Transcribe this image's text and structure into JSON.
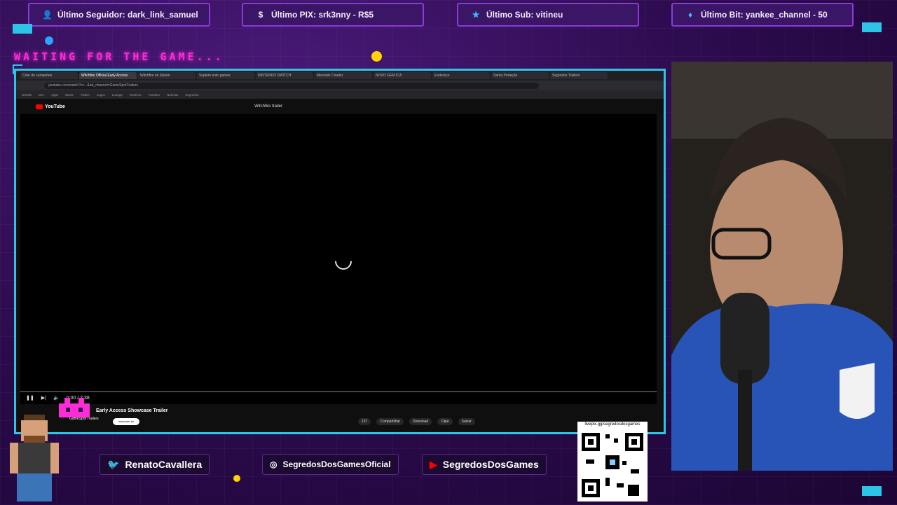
{
  "alerts": {
    "follower": "Último Seguidor: dark_link_samuel",
    "pix": "Último PIX: srk3nny - R$5",
    "sub": "Último Sub: vitineu",
    "bit": "Último Bit: yankee_channel - 50"
  },
  "overlay": {
    "waiting": "WAITING FOR THE GAME..."
  },
  "browser": {
    "tabs": [
      "Criar de campeões",
      "Witchfire Official Early Access",
      "Witchfire no Steam",
      "Suplem ento games",
      "NINTENDO SWITCH",
      "Mercado Criador",
      "NOVO GEM ICA",
      "Endereço",
      "Santa Proteção",
      "Segredos Trailers"
    ],
    "url": "youtube.com/watch?v=...&ab_channel=GameSpotTrailers",
    "bookmarks": [
      "GitHub",
      "Dev",
      "Apps",
      "Music",
      "Twitch",
      "Jogos",
      "Lounge",
      "Roteiros",
      "Fandom",
      "Notícias",
      "Segredos"
    ],
    "youtube_logo": "YouTube",
    "search_value": "Witchfire trailer"
  },
  "video": {
    "time": "0:00 / 2:38",
    "title": "Early Access Showcase Trailer",
    "channel": "GameSpot Trailers",
    "subscribe": "Inscrever-se",
    "actions": [
      "137",
      "Compartilhar",
      "Download",
      "Clipe",
      "Salvar"
    ]
  },
  "social": {
    "twitter": "RenatoCavallera",
    "instagram": "SegredosDosGamesOficial",
    "youtube": "SegredosDosGames"
  },
  "qr": {
    "caption": "livepix.gg/segredosdosgames"
  },
  "colors": {
    "accent_cyan": "#2ec4e8",
    "neon_pink": "#ff2bd6",
    "bg_purple": "#2a0a4a"
  }
}
